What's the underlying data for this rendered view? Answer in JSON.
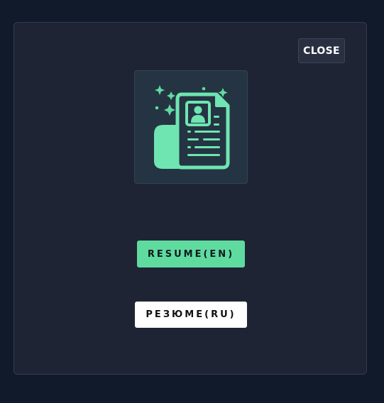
{
  "modal": {
    "close_label": "CLOSE",
    "icon": "resume-document-icon",
    "buttons": {
      "resume_en": "RESUME(EN)",
      "resume_ru": "РЕЗЮМЕ(RU)"
    }
  },
  "colors": {
    "background": "#111a2a",
    "panel": "#1f2435",
    "accent": "#5fdba0",
    "icon_tile": "#253442"
  }
}
